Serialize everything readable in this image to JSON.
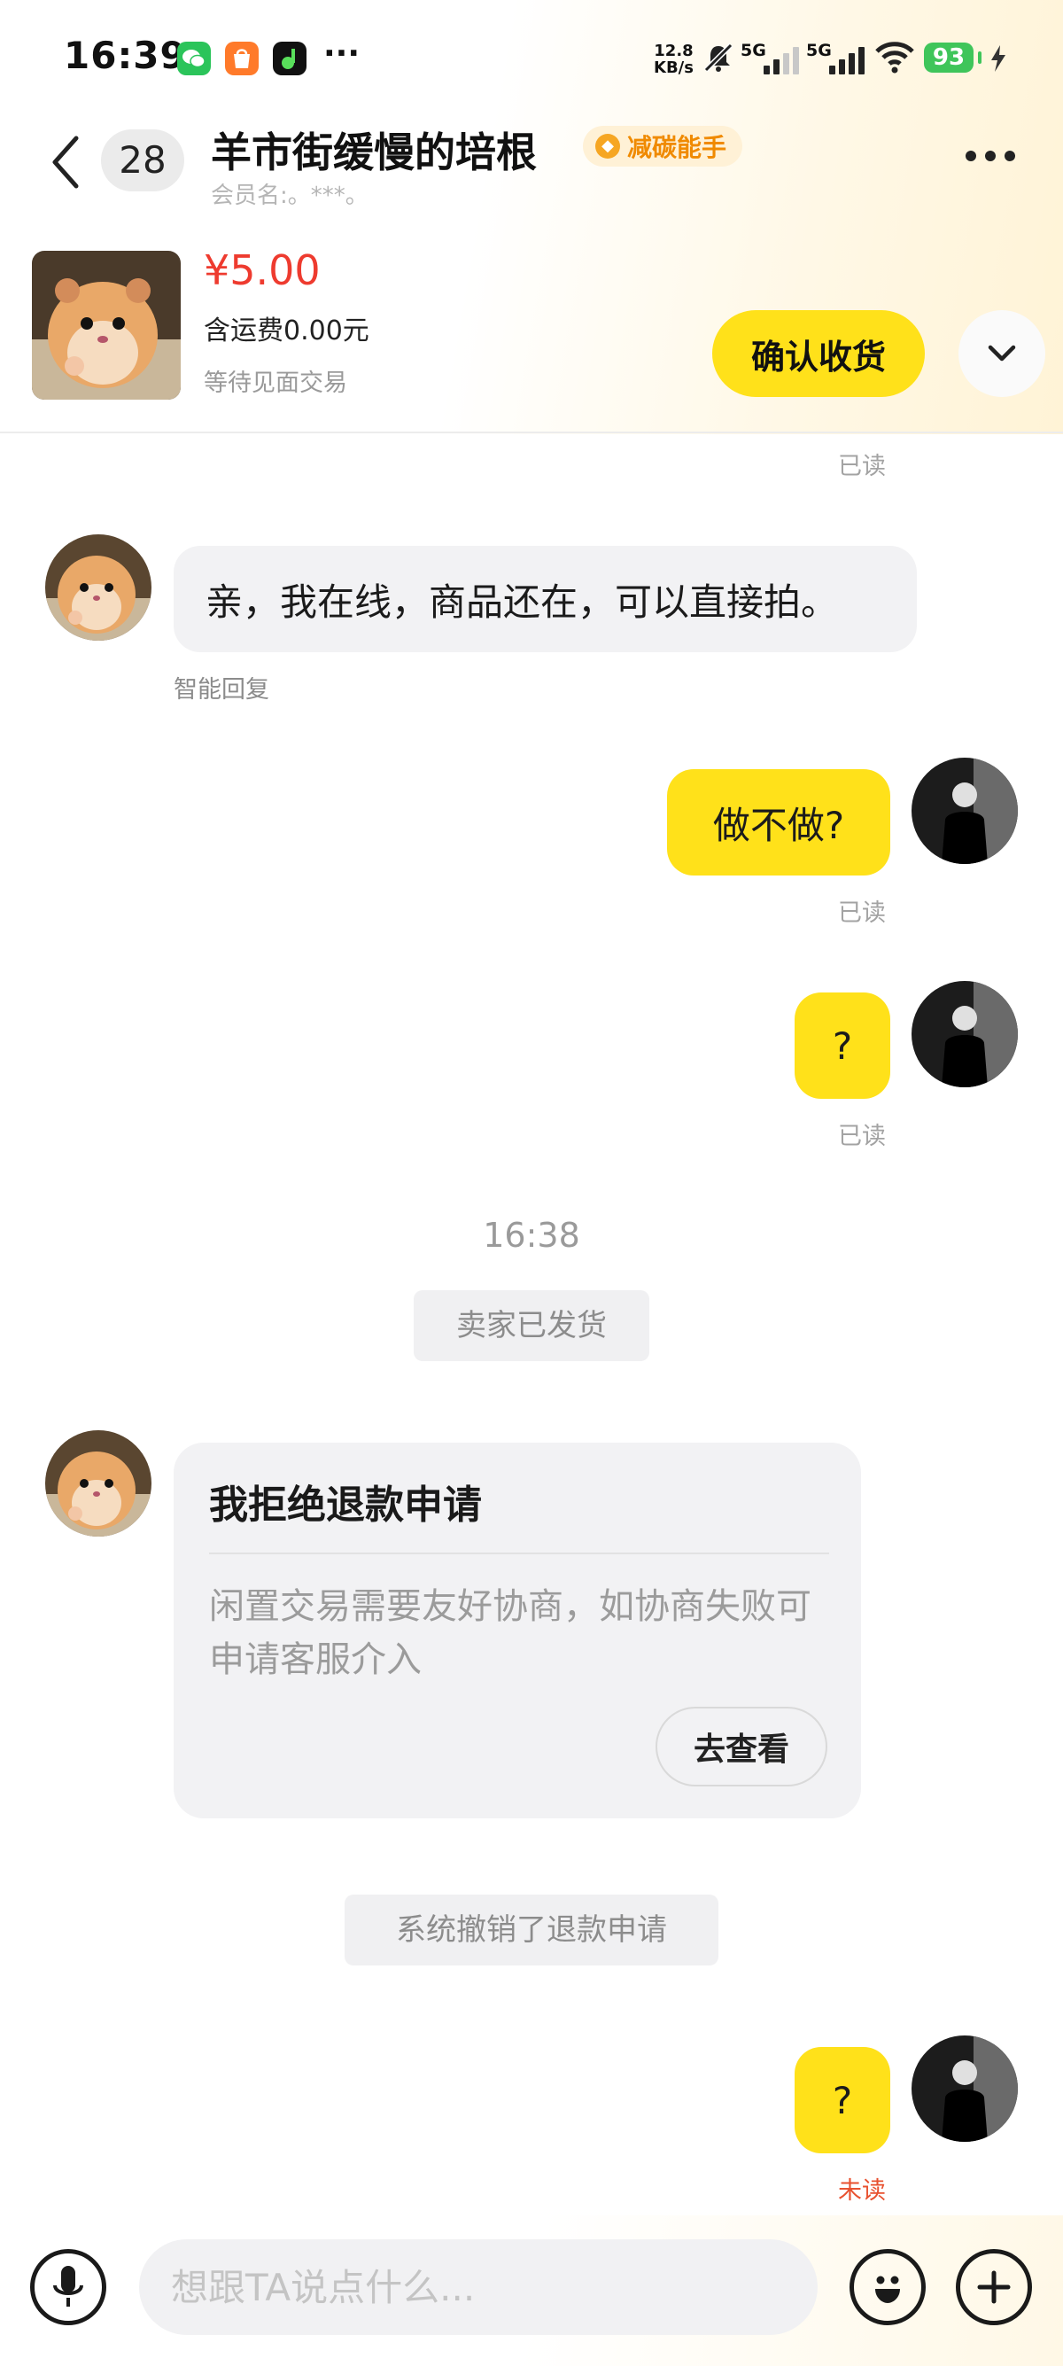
{
  "status_bar": {
    "time": "16:39",
    "more": "···",
    "net_speed_value": "12.8",
    "net_speed_unit": "KB/s",
    "sim1": "5G",
    "sim2": "5G",
    "battery": "93"
  },
  "header": {
    "unread_count": "28",
    "title": "羊市街缓慢的培根",
    "badge": "减碳能手",
    "member": "会员名:。***。"
  },
  "product": {
    "price": "¥5.00",
    "shipping": "含运费0.00元",
    "status": "等待见面交易",
    "confirm_label": "确认收货"
  },
  "chat": {
    "read_top": "已读",
    "seller_msg_1": "亲，我在线，商品还在，可以直接拍。",
    "seller_hint_1": "智能回复",
    "buyer_msg_1": "做不做?",
    "read_1": "已读",
    "buyer_msg_2": "?",
    "read_2": "已读",
    "time_divider": "16:38",
    "system_1": "卖家已发货",
    "card": {
      "title": "我拒绝退款申请",
      "body": "闲置交易需要友好协商，如协商失败可申请客服介入",
      "button": "去查看"
    },
    "system_2": "系统撤销了退款申请",
    "buyer_msg_3": "?",
    "unread_3": "未读"
  },
  "input_bar": {
    "placeholder": "想跟TA说点什么..."
  },
  "colors": {
    "accent_yellow": "#ffe11a",
    "price_red": "#ee3b2f",
    "badge_orange": "#f08a00",
    "unread_red": "#e8512f"
  }
}
